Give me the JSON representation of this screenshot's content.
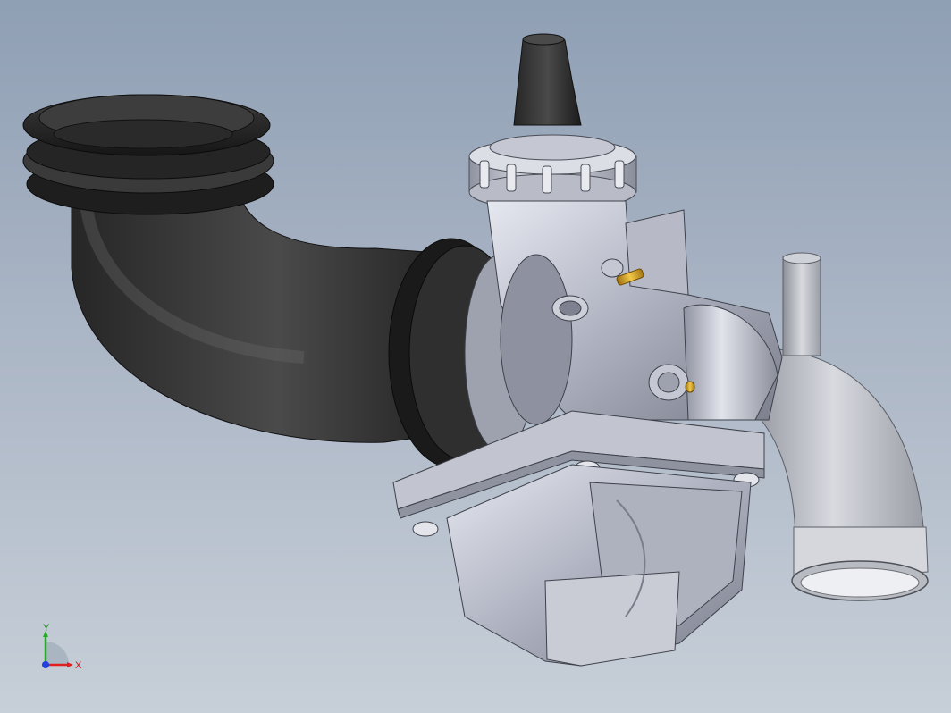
{
  "viewport": {
    "triad": {
      "x_label": "X",
      "y_label": "Y",
      "x_color": "#e02020",
      "y_color": "#20b020",
      "z_color": "#2040e0"
    },
    "colors": {
      "background_top": "#8f9fb4",
      "background_bottom": "#c7cfd8",
      "rubber": "#2b2b2b",
      "metal": "#c8cbd6",
      "brass": "#d4a020"
    },
    "parts": [
      "intake-elbow-hose",
      "carburetor-body",
      "float-bowl",
      "outlet-pipe",
      "vent-tube",
      "throttle-cap",
      "brass-screw"
    ]
  }
}
